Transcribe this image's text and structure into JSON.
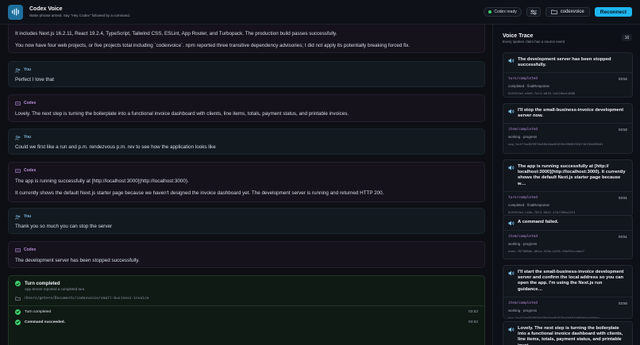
{
  "header": {
    "title": "Codex Voice",
    "subtitle": "Wake phrase armed. Say \"Hey Codex\" followed by a command.",
    "status": "Codex ready",
    "folder": "codexvoice",
    "reconnect_label": "Reconnect"
  },
  "conversation": {
    "top_lines": [
      "It includes Next.js 16.2.11, React 19.2.4, TypeScript, Tailwind CSS, ESLint, App Router, and Turbopack. The production build passes successfully.",
      "You now have four web projects, or five projects total including `codexvoice`. npm reported three transitive dependency advisories; I did not apply its potentially breaking forced fix."
    ],
    "messages": [
      {
        "role": "You",
        "lines": [
          "Perfect I love that"
        ]
      },
      {
        "role": "Codex",
        "lines": [
          "Lovely. The next step is turning the boilerplate into a functional invoice dashboard with clients, line items, totals, payment status, and printable invoices."
        ]
      },
      {
        "role": "You",
        "lines": [
          "Could we first like a run and p.m. rendezvous p.m. rev to see how the application looks like"
        ]
      },
      {
        "role": "Codex",
        "lines": [
          "The app is running successfully at [http://localhost:3000](http://localhost:3000).",
          "It currently shows the default Next.js starter page because we haven't designed the invoice dashboard yet. The development server is running and returned HTTP 200."
        ]
      },
      {
        "role": "You",
        "lines": [
          "Thank you so much you can stop the server"
        ]
      },
      {
        "role": "Codex",
        "lines": [
          "The development server has been stopped successfully."
        ]
      }
    ],
    "turn": {
      "title": "Turn completed",
      "subtitle": "App Server reported a completed turn.",
      "path": "/Users/getere/Documents/codexvoice/small-business-invoice",
      "rows": [
        {
          "label": "Turn completed",
          "time": "03:52"
        },
        {
          "label": "Command succeeded.",
          "time": "03:52"
        }
      ]
    }
  },
  "trace": {
    "title": "Voice Trace",
    "subtitle": "Every spoken claim has a source event",
    "count": "16",
    "cards": [
      {
        "title": "The development server has been stopped successfully.",
        "event": "turn/completed",
        "time": "03:52",
        "state": "completed · finalResponse",
        "id": "019f67ad-e9e9-7a13-b619-2a218ea14888"
      },
      {
        "title": "I'll stop the small-business-invoice development server now.",
        "event": "item/completed",
        "time": "03:52",
        "state": "working · progress",
        "id": "msg_0c4f7ae829976a38b16ad81635e59081916f1819eb99b01"
      },
      {
        "title": "The app is running successfully at [http:// localhost:3000](http://localhost:3000). It currently shows the default Next.js starter page because w…",
        "event": "turn/completed",
        "time": "03:51",
        "state": "completed · finalResponse",
        "id": "019f67ad-c49a-78f3-9b42-47d7186a13f3"
      },
      {
        "title": "A command failed.",
        "event": "item/completed",
        "time": "03:51",
        "state": "working · progress",
        "id": "exec-767968de-d81a-423b-b370-f0bf91ccda47"
      },
      {
        "title": "I'll start the small-business-invoice development server and confirm the local address so you can open the app. I'm using the Next.js run guidance…",
        "event": "item/completed",
        "time": "03:50",
        "state": "working · progress",
        "id": "msg_0c4f7ae829976a38b16ad81635e5a681b669d4a448d4a"
      },
      {
        "title": "Lovely. The next step is turning the boilerplate into a functional invoice dashboard with clients, line items, totals, payment status, and printable invoi…",
        "event": "",
        "time": "",
        "state": "",
        "id": ""
      }
    ]
  },
  "colors": {
    "accent": "#1eb5ef",
    "success": "#3fcf6b",
    "codex_label": "#b98fdc",
    "user_label": "#7fb3d8"
  }
}
